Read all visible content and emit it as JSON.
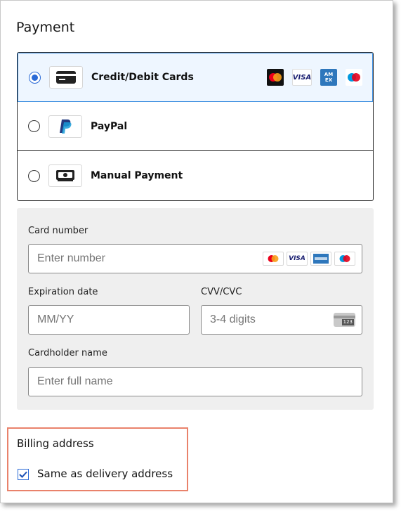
{
  "payment": {
    "title": "Payment",
    "methods": [
      {
        "label": "Credit/Debit Cards",
        "selected": true,
        "icon": "credit-card-icon"
      },
      {
        "label": "PayPal",
        "selected": false,
        "icon": "paypal-icon"
      },
      {
        "label": "Manual Payment",
        "selected": false,
        "icon": "cash-icon"
      }
    ],
    "card_brands": [
      "mastercard",
      "visa",
      "amex",
      "maestro"
    ],
    "brand_text": {
      "visa": "VISA",
      "amex": "AM EX"
    },
    "colors": {
      "accent": "#2a6ad6",
      "selected_bg": "#eef6ff",
      "selected_border": "#3d8fe0",
      "billing_highlight": "#e9826b"
    }
  },
  "card_form": {
    "card_number": {
      "label": "Card number",
      "placeholder": "Enter number",
      "value": ""
    },
    "expiration": {
      "label": "Expiration date",
      "placeholder": "MM/YY",
      "value": ""
    },
    "cvv": {
      "label": "CVV/CVC",
      "placeholder": "3-4 digits",
      "value": "",
      "hint_text": "123"
    },
    "cardholder": {
      "label": "Cardholder name",
      "placeholder": "Enter full name",
      "value": ""
    }
  },
  "billing": {
    "title": "Billing address",
    "same_as_delivery": {
      "label": "Same as delivery address",
      "checked": true
    }
  }
}
